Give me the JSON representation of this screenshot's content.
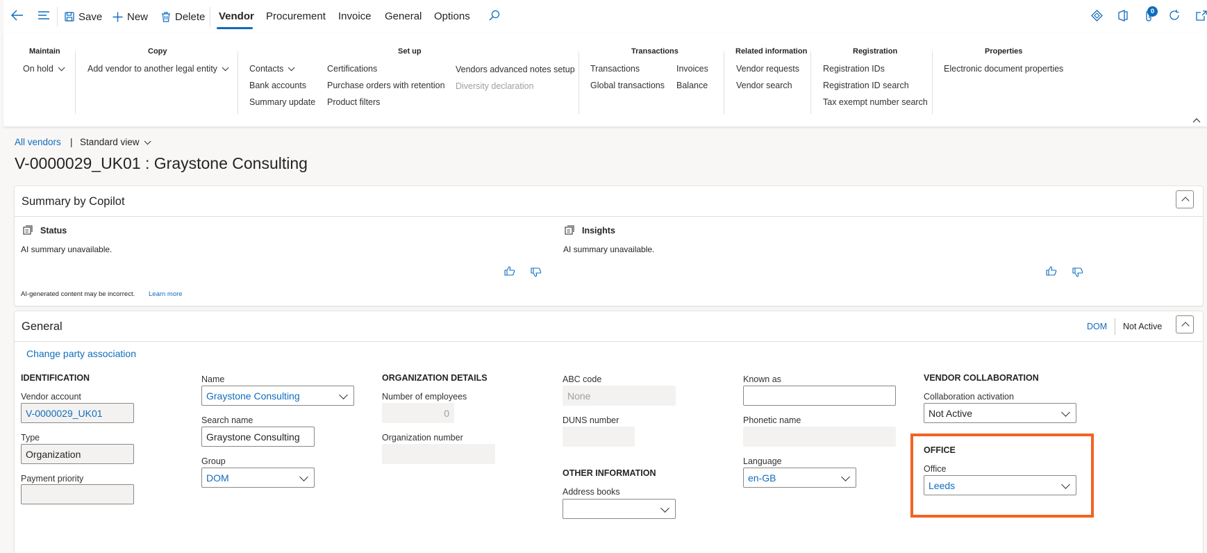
{
  "toolbar": {
    "save": "Save",
    "new": "New",
    "delete": "Delete",
    "tabs": [
      "Vendor",
      "Procurement",
      "Invoice",
      "General",
      "Options"
    ],
    "notification_count": "0"
  },
  "ribbon": {
    "groups": {
      "maintain": "Maintain",
      "copy": "Copy",
      "setup": "Set up",
      "transactions": "Transactions",
      "related": "Related information",
      "registration": "Registration",
      "properties": "Properties"
    },
    "maintain_items": [
      "On hold"
    ],
    "copy_items": [
      "Add vendor to another legal entity"
    ],
    "setup_col1": [
      "Contacts",
      "Bank accounts",
      "Summary update"
    ],
    "setup_col2": [
      "Certifications",
      "Purchase orders with retention",
      "Product filters"
    ],
    "setup_col3": [
      "Vendors advanced notes setup",
      "Diversity declaration"
    ],
    "trans_col1": [
      "Transactions",
      "Global transactions"
    ],
    "trans_col2": [
      "Invoices",
      "Balance"
    ],
    "related_items": [
      "Vendor requests",
      "Vendor search"
    ],
    "registration_items": [
      "Registration IDs",
      "Registration ID search",
      "Tax exempt number search"
    ],
    "properties_items": [
      "Electronic document properties"
    ]
  },
  "breadcrumb": {
    "all_vendors": "All vendors",
    "separator": "|",
    "view": "Standard view"
  },
  "page_title": "V-0000029_UK01 : Graystone Consulting",
  "copilot": {
    "title": "Summary by Copilot",
    "status_label": "Status",
    "status_text": "AI summary unavailable.",
    "insights_label": "Insights",
    "insights_text": "AI summary unavailable.",
    "disclaimer": "AI-generated content may be incorrect.",
    "learn_more": "Learn more"
  },
  "general": {
    "title": "General",
    "dom_tag": "DOM",
    "status": "Not Active",
    "change_party": "Change party association",
    "identification": {
      "heading": "IDENTIFICATION",
      "vendor_account_label": "Vendor account",
      "vendor_account": "V-0000029_UK01",
      "type_label": "Type",
      "type": "Organization",
      "payment_priority_label": "Payment priority",
      "payment_priority": ""
    },
    "name_col": {
      "name_label": "Name",
      "name": "Graystone Consulting",
      "search_name_label": "Search name",
      "search_name": "Graystone Consulting",
      "group_label": "Group",
      "group": "DOM"
    },
    "org": {
      "heading": "ORGANIZATION DETAILS",
      "employees_label": "Number of employees",
      "employees": "0",
      "org_number_label": "Organization number",
      "org_number": ""
    },
    "abc": {
      "abc_label": "ABC code",
      "abc": "None",
      "duns_label": "DUNS number",
      "duns": "",
      "other_heading": "OTHER INFORMATION",
      "address_books_label": "Address books",
      "address_books": ""
    },
    "known": {
      "known_as_label": "Known as",
      "known_as": "",
      "phonetic_label": "Phonetic name",
      "phonetic": "",
      "language_label": "Language",
      "language": "en-GB"
    },
    "collab": {
      "heading": "VENDOR COLLABORATION",
      "activation_label": "Collaboration activation",
      "activation": "Not Active",
      "office_heading": "OFFICE",
      "office_label": "Office",
      "office": "Leeds"
    }
  },
  "colors": {
    "accent": "#0f6cbd",
    "highlight": "#f26322"
  }
}
